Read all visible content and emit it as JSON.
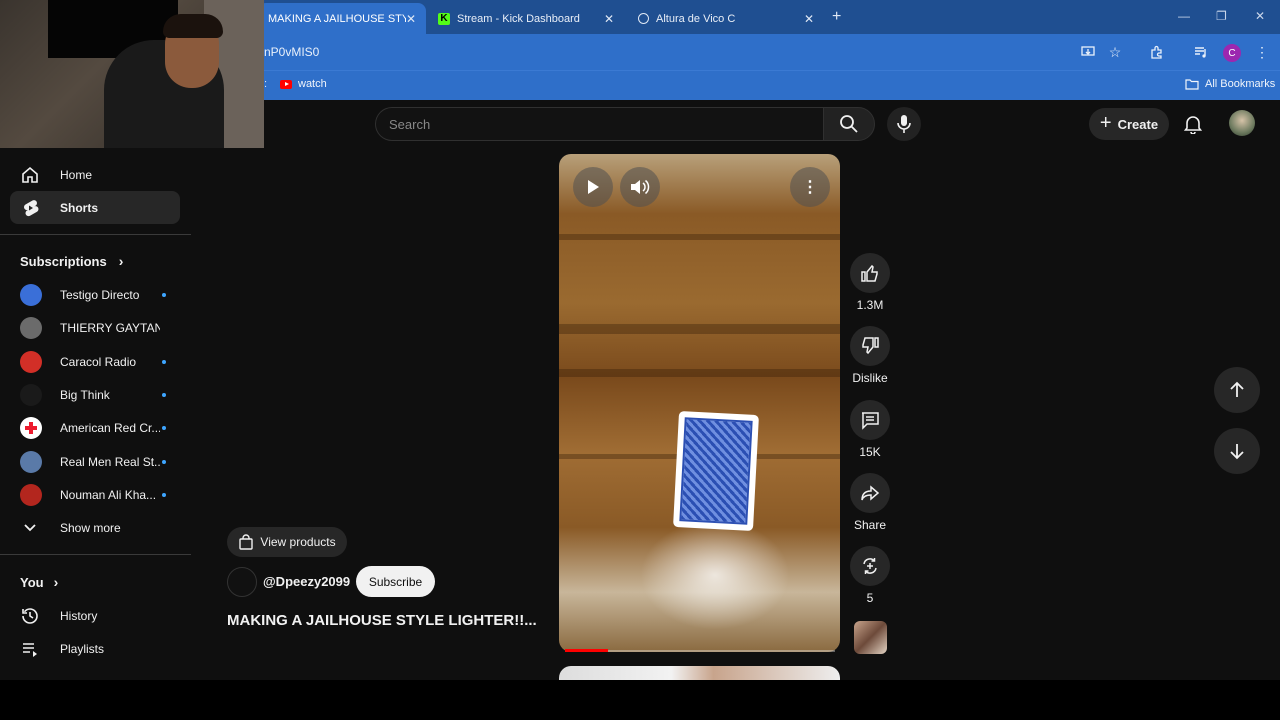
{
  "browser": {
    "tabs": [
      {
        "title": "MAKING A JAILHOUSE STYLE LI",
        "favicon": "youtube-icon"
      },
      {
        "title": "Stream - Kick Dashboard",
        "favicon": "kick-icon"
      },
      {
        "title": "Altura de Vico C",
        "favicon": "web-icon"
      }
    ],
    "url": "nP0vMIS0",
    "profile_initial": "C",
    "bookmarks": [
      {
        "label": "watch"
      }
    ],
    "all_bookmarks": "All Bookmarks"
  },
  "header": {
    "search_placeholder": "Search",
    "create_label": "Create"
  },
  "sidebar": {
    "nav": [
      {
        "label": "Home",
        "icon": "home-icon"
      },
      {
        "label": "Shorts",
        "icon": "shorts-icon",
        "active": true
      }
    ],
    "subscriptions_title": "Subscriptions",
    "subscriptions": [
      {
        "label": "Testigo Directo",
        "color": "#3a6fd8",
        "new": true
      },
      {
        "label": "THIERRY GAYTAN",
        "color": "#6b6b6b",
        "new": false
      },
      {
        "label": "Caracol Radio",
        "color": "#d22f27",
        "new": true
      },
      {
        "label": "Big Think",
        "color": "#1a1a1a",
        "new": true
      },
      {
        "label": "American Red Cr...",
        "color": "#ffffff",
        "new": true
      },
      {
        "label": "Real Men Real St...",
        "color": "#5a7aa8",
        "new": true
      },
      {
        "label": "Nouman Ali Kha...",
        "color": "#b3261e",
        "new": true
      }
    ],
    "show_more": "Show more",
    "you_title": "You",
    "you_items": [
      {
        "label": "History",
        "icon": "history-icon"
      },
      {
        "label": "Playlists",
        "icon": "playlists-icon"
      }
    ]
  },
  "short": {
    "view_products": "View products",
    "channel": "@Dpeezy2099",
    "subscribe": "Subscribe",
    "title": "MAKING A JAILHOUSE STYLE LIGHTER!!...",
    "progress": 0.16,
    "actions": {
      "likes": "1.3M",
      "dislike": "Dislike",
      "comments": "15K",
      "share": "Share",
      "remix": "5"
    }
  },
  "colors": {
    "accent_red": "#ff0000",
    "chrome_blue": "#2f6fc9",
    "background": "#0f0f0f"
  }
}
